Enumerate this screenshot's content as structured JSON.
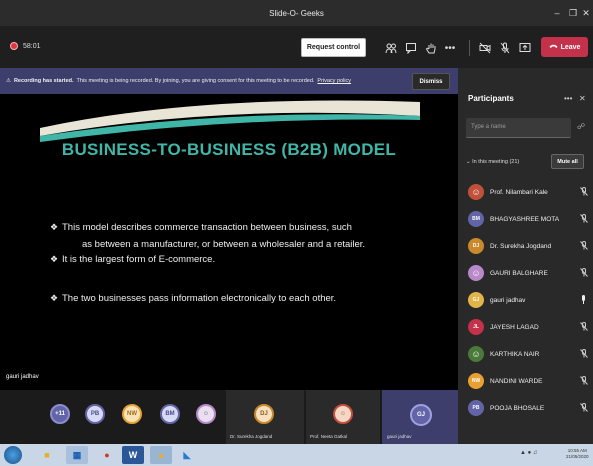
{
  "window": {
    "title": "Slide-O- Geeks"
  },
  "toolbar": {
    "timer": "58:01",
    "request_control_label": "Request control",
    "leave_label": "Leave"
  },
  "banner": {
    "bold": "Recording has started.",
    "text": "This meeting is being recorded. By joining, you are giving consent for this meeting to be recorded.",
    "link": "Privacy policy",
    "dismiss_label": "Dismiss"
  },
  "slide": {
    "title": "BUSINESS-TO-BUSINESS (B2B) MODEL",
    "bullets": [
      {
        "line1": "This model describes commerce transaction between business, such",
        "line2": "as between a manufacturer, or between a wholesaler and a retailer."
      },
      {
        "line1": "It is the largest form of E-commerce.",
        "line2": ""
      },
      {
        "line1": "The two businesses pass information electronically to each other.",
        "line2": ""
      }
    ],
    "presenter_caption": "gauri jadhav"
  },
  "participants": {
    "title": "Participants",
    "search_placeholder": "Type a name",
    "in_meeting_label": "In this meeting (21)",
    "mute_all_label": "Mute all",
    "list": [
      {
        "initials": "",
        "name": "Prof. Nilambari Kale",
        "color": "#c0503a"
      },
      {
        "initials": "BM",
        "name": "BHAGYASHREE MOTA",
        "color": "#6264a7"
      },
      {
        "initials": "DJ",
        "name": "Dr. Surekha Jogdand",
        "color": "#ca8a2b"
      },
      {
        "initials": "",
        "name": "GAURI BALGHARE",
        "color": "#b888c8"
      },
      {
        "initials": "GJ",
        "name": "gauri jadhav",
        "color": "#e2b44a"
      },
      {
        "initials": "JL",
        "name": "JAYESH LAGAD",
        "color": "#c4314b"
      },
      {
        "initials": "",
        "name": "KARTHIKA NAIR",
        "color": "#4a7a3a"
      },
      {
        "initials": "NW",
        "name": "NANDINI WARDE",
        "color": "#e8a032"
      },
      {
        "initials": "PB",
        "name": "POOJA BHOSALE",
        "color": "#6264a7"
      }
    ]
  },
  "strip": {
    "more_count": "+11",
    "avatars": [
      {
        "initials": "PB",
        "bg": "#d8daf5",
        "border": "#6264a7",
        "color": "#4a4c8c"
      },
      {
        "initials": "NW",
        "bg": "#f9e2b8",
        "border": "#e8a032",
        "color": "#9a6a10"
      },
      {
        "initials": "BM",
        "bg": "#d8daf5",
        "border": "#6264a7",
        "color": "#4a4c8c"
      }
    ],
    "tiles": [
      {
        "initials": "DJ",
        "label": "Dr. Surekha Jogdand"
      },
      {
        "initials": "",
        "label": "Prof. Neeta Gatkal"
      },
      {
        "initials": "GJ",
        "label": "gauri jadhav"
      }
    ]
  },
  "taskbar": {
    "time": "10:55 AM",
    "date": "21/05/2020"
  }
}
